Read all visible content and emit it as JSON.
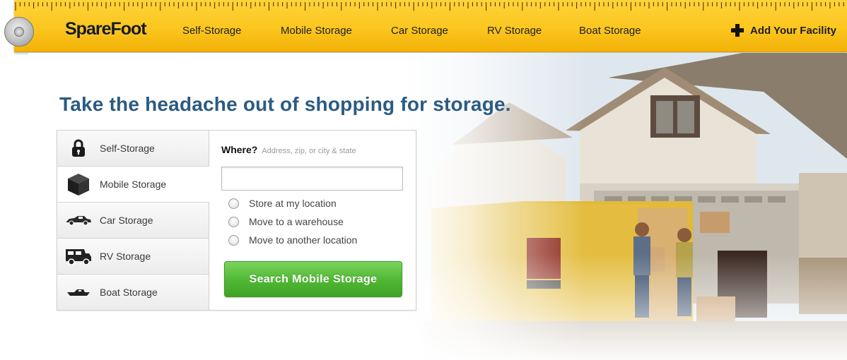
{
  "brand": {
    "logo_text": "SpareFoot"
  },
  "nav": {
    "links": [
      "Self-Storage",
      "Mobile Storage",
      "Car Storage",
      "RV Storage",
      "Boat Storage"
    ],
    "add_facility_label": "Add Your Facility"
  },
  "hero": {
    "headline": "Take the headache out of shopping for storage."
  },
  "widget": {
    "tabs": [
      {
        "label": "Self-Storage",
        "icon": "padlock-icon"
      },
      {
        "label": "Mobile Storage",
        "icon": "box-icon",
        "active": true
      },
      {
        "label": "Car Storage",
        "icon": "car-icon"
      },
      {
        "label": "RV Storage",
        "icon": "rv-icon"
      },
      {
        "label": "Boat Storage",
        "icon": "boat-icon"
      }
    ],
    "where_label": "Where?",
    "where_hint": "Address, zip, or city & state",
    "location_value": "",
    "options": [
      "Store at my location",
      "Move to a warehouse",
      "Move to another location"
    ],
    "search_button": "Search Mobile Storage"
  },
  "colors": {
    "accent_yellow": "#fbc61e",
    "headline_blue": "#2b5b82",
    "button_green": "#52b936"
  }
}
